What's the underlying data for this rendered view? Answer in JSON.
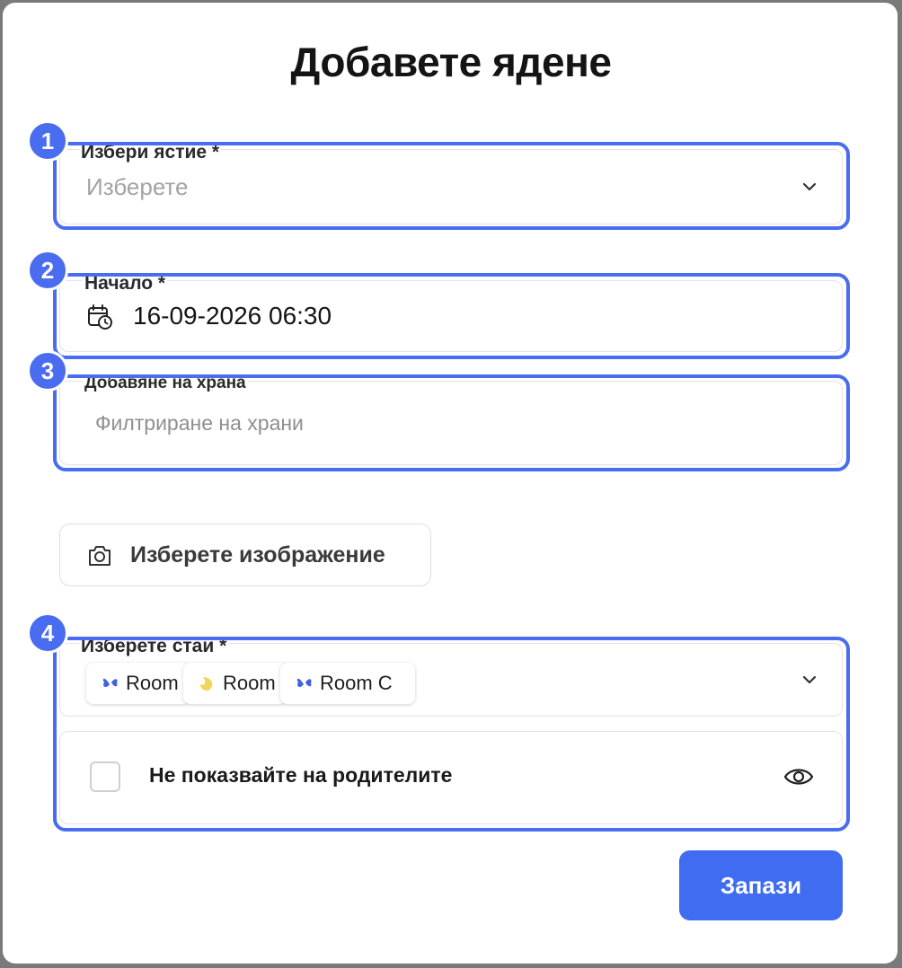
{
  "modal": {
    "title": "Добавете ядене",
    "badges": [
      "1",
      "2",
      "3",
      "4"
    ],
    "dish": {
      "label": "Избери ястие *",
      "placeholder": "Изберете"
    },
    "start": {
      "label": "Начало *",
      "value": "16-09-2026 06:30"
    },
    "food": {
      "label": "Добавяне на храна",
      "placeholder": "Филтриране на храни"
    },
    "image_button": {
      "label": "Изберете изображение"
    },
    "rooms": {
      "label": "Изберете стаи *",
      "chips": [
        {
          "label": "Room",
          "icon": "butterfly-icon",
          "color": "#3f63e0"
        },
        {
          "label": "Room",
          "icon": "moon-icon",
          "color": "#f2d55a"
        },
        {
          "label": "Room C",
          "icon": "butterfly-icon",
          "color": "#3f63e0"
        }
      ]
    },
    "hide_parents": {
      "label": "Не показвайте на родителите",
      "checked": false
    },
    "save_button": {
      "label": "Запази"
    }
  },
  "colors": {
    "accent": "#4a6cf0",
    "button": "#3f6cf0"
  }
}
